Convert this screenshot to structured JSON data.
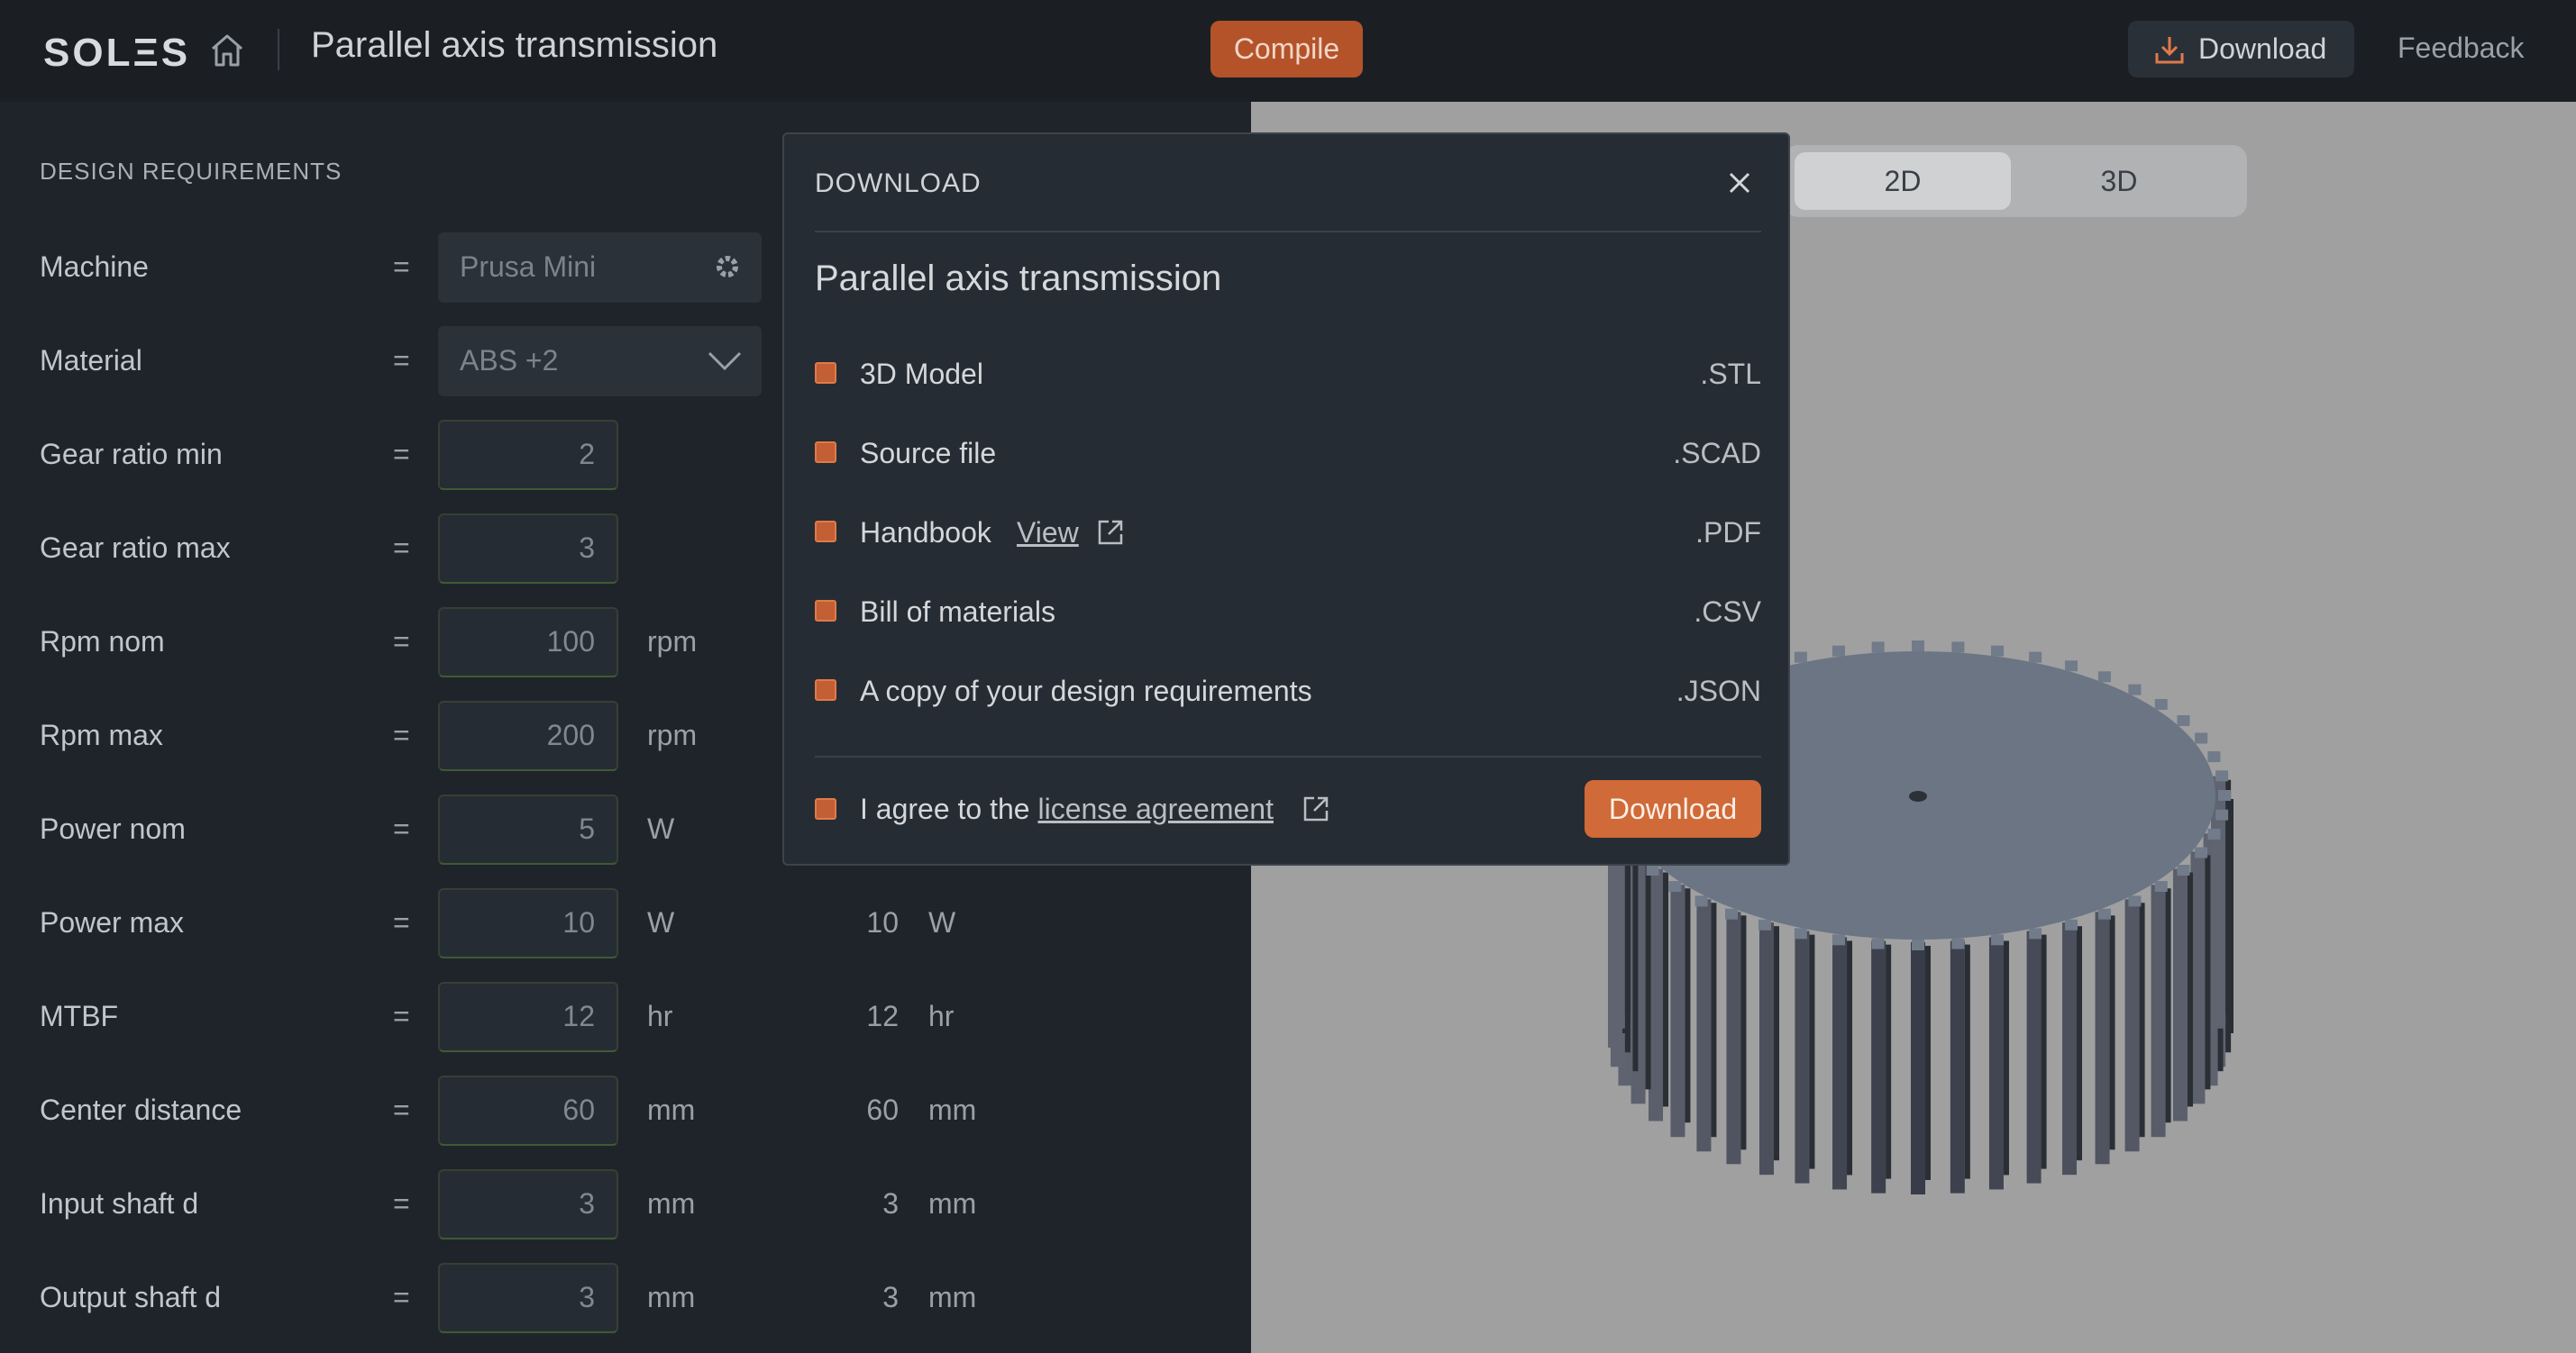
{
  "header": {
    "logo": "SOLΞS",
    "title": "Parallel axis transmission",
    "compile_label": "Compile",
    "download_label": "Download",
    "feedback_label": "Feedback"
  },
  "panel": {
    "section_title": "DESIGN REQUIREMENTS",
    "machine": {
      "label": "Machine",
      "value": "Prusa Mini"
    },
    "material": {
      "label": "Material",
      "value": "ABS  +2"
    },
    "rows": [
      {
        "label": "Gear ratio min",
        "value": "2",
        "unit": "",
        "result": "",
        "result_unit": ""
      },
      {
        "label": "Gear ratio max",
        "value": "3",
        "unit": "",
        "result": "",
        "result_unit": ""
      },
      {
        "label": "Rpm nom",
        "value": "100",
        "unit": "rpm",
        "result": "",
        "result_unit": ""
      },
      {
        "label": "Rpm max",
        "value": "200",
        "unit": "rpm",
        "result": "",
        "result_unit": ""
      },
      {
        "label": "Power nom",
        "value": "5",
        "unit": "W",
        "result": "",
        "result_unit": ""
      },
      {
        "label": "Power max",
        "value": "10",
        "unit": "W",
        "result": "10",
        "result_unit": "W"
      },
      {
        "label": "MTBF",
        "value": "12",
        "unit": "hr",
        "result": "12",
        "result_unit": "hr"
      },
      {
        "label": "Center distance",
        "value": "60",
        "unit": "mm",
        "result": "60",
        "result_unit": "mm"
      },
      {
        "label": "Input shaft d",
        "value": "3",
        "unit": "mm",
        "result": "3",
        "result_unit": "mm"
      },
      {
        "label": "Output shaft d",
        "value": "3",
        "unit": "mm",
        "result": "3",
        "result_unit": "mm"
      }
    ],
    "eq": "="
  },
  "viewer": {
    "tab_2d": "2D",
    "tab_3d": "3D",
    "active_tab": "2D"
  },
  "modal": {
    "header": "DOWNLOAD",
    "title": "Parallel axis transmission",
    "items": [
      {
        "label": "3D Model",
        "ext": ".STL",
        "checked": true
      },
      {
        "label": "Source file",
        "ext": ".SCAD",
        "checked": true
      },
      {
        "label": "Handbook",
        "ext": ".PDF",
        "checked": true,
        "link": "View"
      },
      {
        "label": "Bill of materials",
        "ext": ".CSV",
        "checked": true
      },
      {
        "label": "A copy of your design requirements",
        "ext": ".JSON",
        "checked": true
      }
    ],
    "agree_prefix": "I agree to the ",
    "agree_link": "license agreement",
    "download_label": "Download"
  },
  "colors": {
    "accent": "#d06a38",
    "compile": "#b4532a",
    "background": "#1e2329",
    "viewer_bg": "#a0a0a0"
  }
}
